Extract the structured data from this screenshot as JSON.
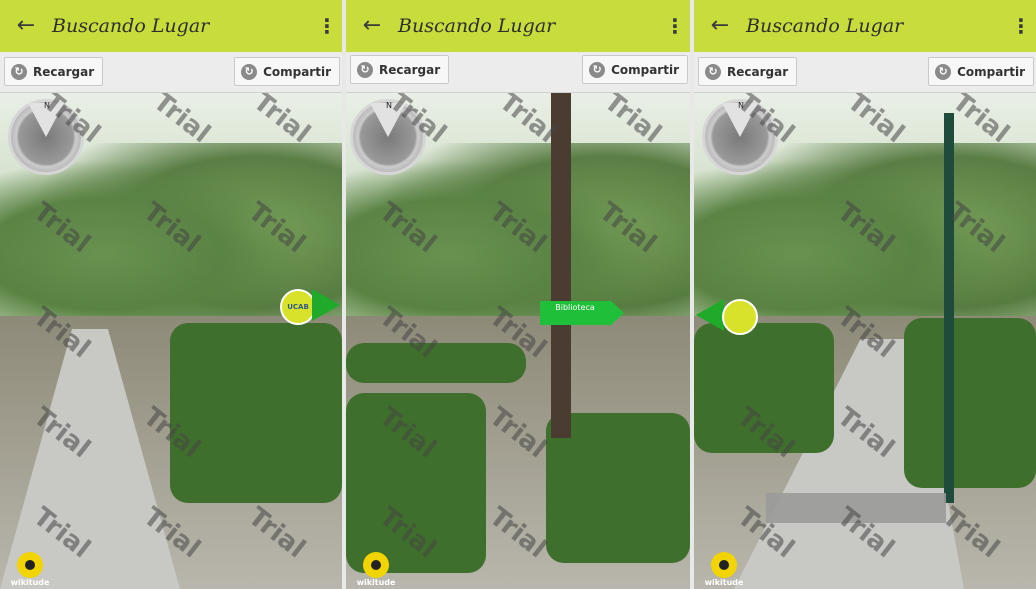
{
  "screens": [
    {
      "title": "Buscando Lugar",
      "reload_label": "Recargar",
      "share_label": "Compartir",
      "marker_label": "UCAB",
      "logo_label": "wikitude"
    },
    {
      "title": "Buscando Lugar",
      "reload_label": "Recargar",
      "share_label": "Compartir",
      "sign_label": "Biblioteca",
      "logo_label": "wikitude"
    },
    {
      "title": "Buscando Lugar",
      "reload_label": "Recargar",
      "share_label": "Compartir",
      "logo_label": "wikitude"
    }
  ],
  "watermark": "Trial",
  "icons": {
    "back": "arrow-left-icon",
    "menu": "more-vert-icon",
    "reload": "refresh-icon",
    "share": "refresh-icon",
    "radar": "radar-icon",
    "logo": "wikitude-eye-icon"
  },
  "colors": {
    "app_bar": "#c8dd3c",
    "arrow": "#1faa2a",
    "marker": "#d8e22a"
  }
}
